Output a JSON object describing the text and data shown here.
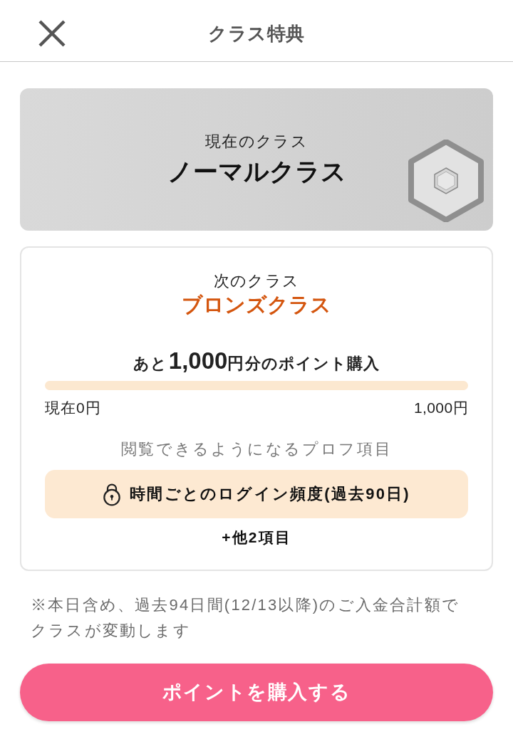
{
  "header": {
    "title": "クラス特典"
  },
  "current_class": {
    "label": "現在のクラス",
    "name": "ノーマルクラス"
  },
  "next_class": {
    "label": "次のクラス",
    "name": "ブロンズクラス",
    "requirement": {
      "before": "あと",
      "amount": "1,000",
      "unit": "円",
      "after": "分のポイント購入"
    },
    "progress": {
      "start_label": "現在0円",
      "end_label": "1,000円"
    },
    "unlock_heading": "閲覧できるようになるプロフ項目",
    "unlock_items": [
      {
        "label": "時間ごとのログイン頻度(過去90日)",
        "locked": true
      }
    ],
    "more": "+他2項目"
  },
  "note": "※本日含め、過去94日間(12/13以降)のご入金合計額でクラスが変動します",
  "buy_button": {
    "label": "ポイントを購入する"
  }
}
